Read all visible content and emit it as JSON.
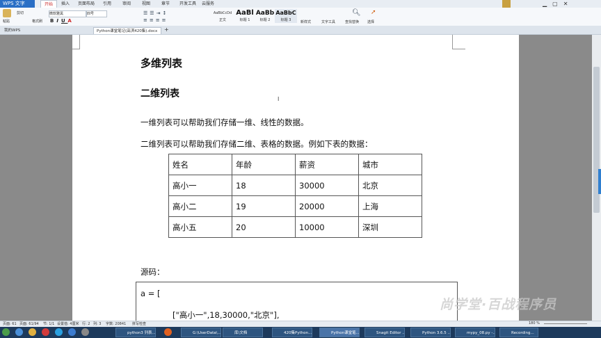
{
  "app": {
    "name": "WPS 文字",
    "menus": [
      "开始",
      "插入",
      "页面布局",
      "引用",
      "审阅",
      "视图",
      "章节",
      "开发工具",
      "云服务"
    ],
    "active_menu": "开始"
  },
  "ribbon": {
    "paste": "粘贴",
    "cut": "剪切",
    "format_painter": "格式刷",
    "font_name": "微软雅黑",
    "font_size": "四号",
    "styles": [
      {
        "preview": "AaBbCcDd",
        "name": "正文"
      },
      {
        "preview": "AaBl",
        "name": "标题 1"
      },
      {
        "preview": "AaBb",
        "name": "标题 2"
      },
      {
        "preview": "AaBbC",
        "name": "标题 3"
      }
    ],
    "new_style": "新样式",
    "text_tools": "文字工具",
    "find_replace": "查找替换",
    "select": "选择"
  },
  "tabs": [
    "我的WPS",
    "Python课堂笔记(高淇420集).docx"
  ],
  "document": {
    "heading1": "多维列表",
    "heading2": "二维列表",
    "para1": "一维列表可以帮助我们存储一维、线性的数据。",
    "para2": "二维列表可以帮助我们存储二维、表格的数据。例如下表的数据：",
    "table": [
      [
        "姓名",
        "年龄",
        "薪资",
        "城市"
      ],
      [
        "高小一",
        "18",
        "30000",
        "北京"
      ],
      [
        "高小二",
        "19",
        "20000",
        "上海"
      ],
      [
        "高小五",
        "20",
        "10000",
        "深圳"
      ]
    ],
    "source_label": "源码：",
    "code": [
      "a = [",
      "[\"高小一\",18,30000,\"北京\"],"
    ]
  },
  "status": {
    "page": "页面: 61",
    "pages": "页面: 61/94",
    "section": "节: 1/1",
    "settings": "设置值: 4厘米",
    "row": "行: 2",
    "col": "列: 3",
    "words": "字数: 20841",
    "spell": "拼写检查",
    "zoom": "180 %"
  },
  "taskbar": [
    "python3 列表...",
    "G:\\UserData\\...",
    "库\\文档",
    "420集Python...",
    "Python课堂笔...",
    "Snagit Editor ...",
    "Python 3.6.5 ...",
    "mypy_08.py -...",
    "Recording..."
  ],
  "watermark": "尚学堂·百战程序员",
  "colors": {
    "accent": "#2a6fc5",
    "taskbar": "#1d3a5c"
  }
}
